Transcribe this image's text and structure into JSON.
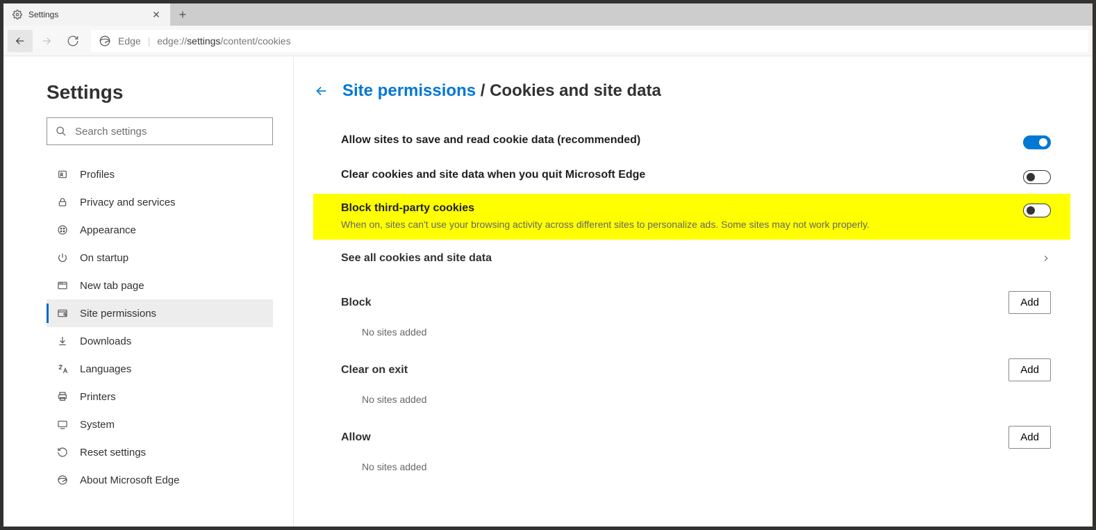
{
  "tab": {
    "title": "Settings"
  },
  "toolbar": {
    "site_label": "Edge",
    "url_prefix": "edge://",
    "url_dark": "settings",
    "url_suffix": "/content/cookies"
  },
  "sidebar": {
    "heading": "Settings",
    "search_placeholder": "Search settings",
    "items": [
      {
        "label": "Profiles",
        "icon": "profile-icon"
      },
      {
        "label": "Privacy and services",
        "icon": "lock-icon"
      },
      {
        "label": "Appearance",
        "icon": "appearance-icon"
      },
      {
        "label": "On startup",
        "icon": "power-icon"
      },
      {
        "label": "New tab page",
        "icon": "newtab-icon"
      },
      {
        "label": "Site permissions",
        "icon": "permissions-icon"
      },
      {
        "label": "Downloads",
        "icon": "download-icon"
      },
      {
        "label": "Languages",
        "icon": "language-icon"
      },
      {
        "label": "Printers",
        "icon": "printer-icon"
      },
      {
        "label": "System",
        "icon": "system-icon"
      },
      {
        "label": "Reset settings",
        "icon": "reset-icon"
      },
      {
        "label": "About Microsoft Edge",
        "icon": "edge-icon"
      }
    ],
    "selected_index": 5
  },
  "main": {
    "breadcrumb_link": "Site permissions",
    "breadcrumb_sep": " / ",
    "breadcrumb_current": "Cookies and site data",
    "rows": {
      "allow_save": {
        "title": "Allow sites to save and read cookie data (recommended)",
        "on": true
      },
      "clear_on_quit": {
        "title": "Clear cookies and site data when you quit Microsoft Edge",
        "on": false
      },
      "block_third": {
        "title": "Block third-party cookies",
        "desc": "When on, sites can't use your browsing activity across different sites to personalize ads. Some sites may not work properly.",
        "on": false
      },
      "see_all": {
        "title": "See all cookies and site data"
      }
    },
    "sections": {
      "block": {
        "title": "Block",
        "add_label": "Add",
        "empty": "No sites added"
      },
      "clear_exit": {
        "title": "Clear on exit",
        "add_label": "Add",
        "empty": "No sites added"
      },
      "allow": {
        "title": "Allow",
        "add_label": "Add",
        "empty": "No sites added"
      }
    }
  }
}
